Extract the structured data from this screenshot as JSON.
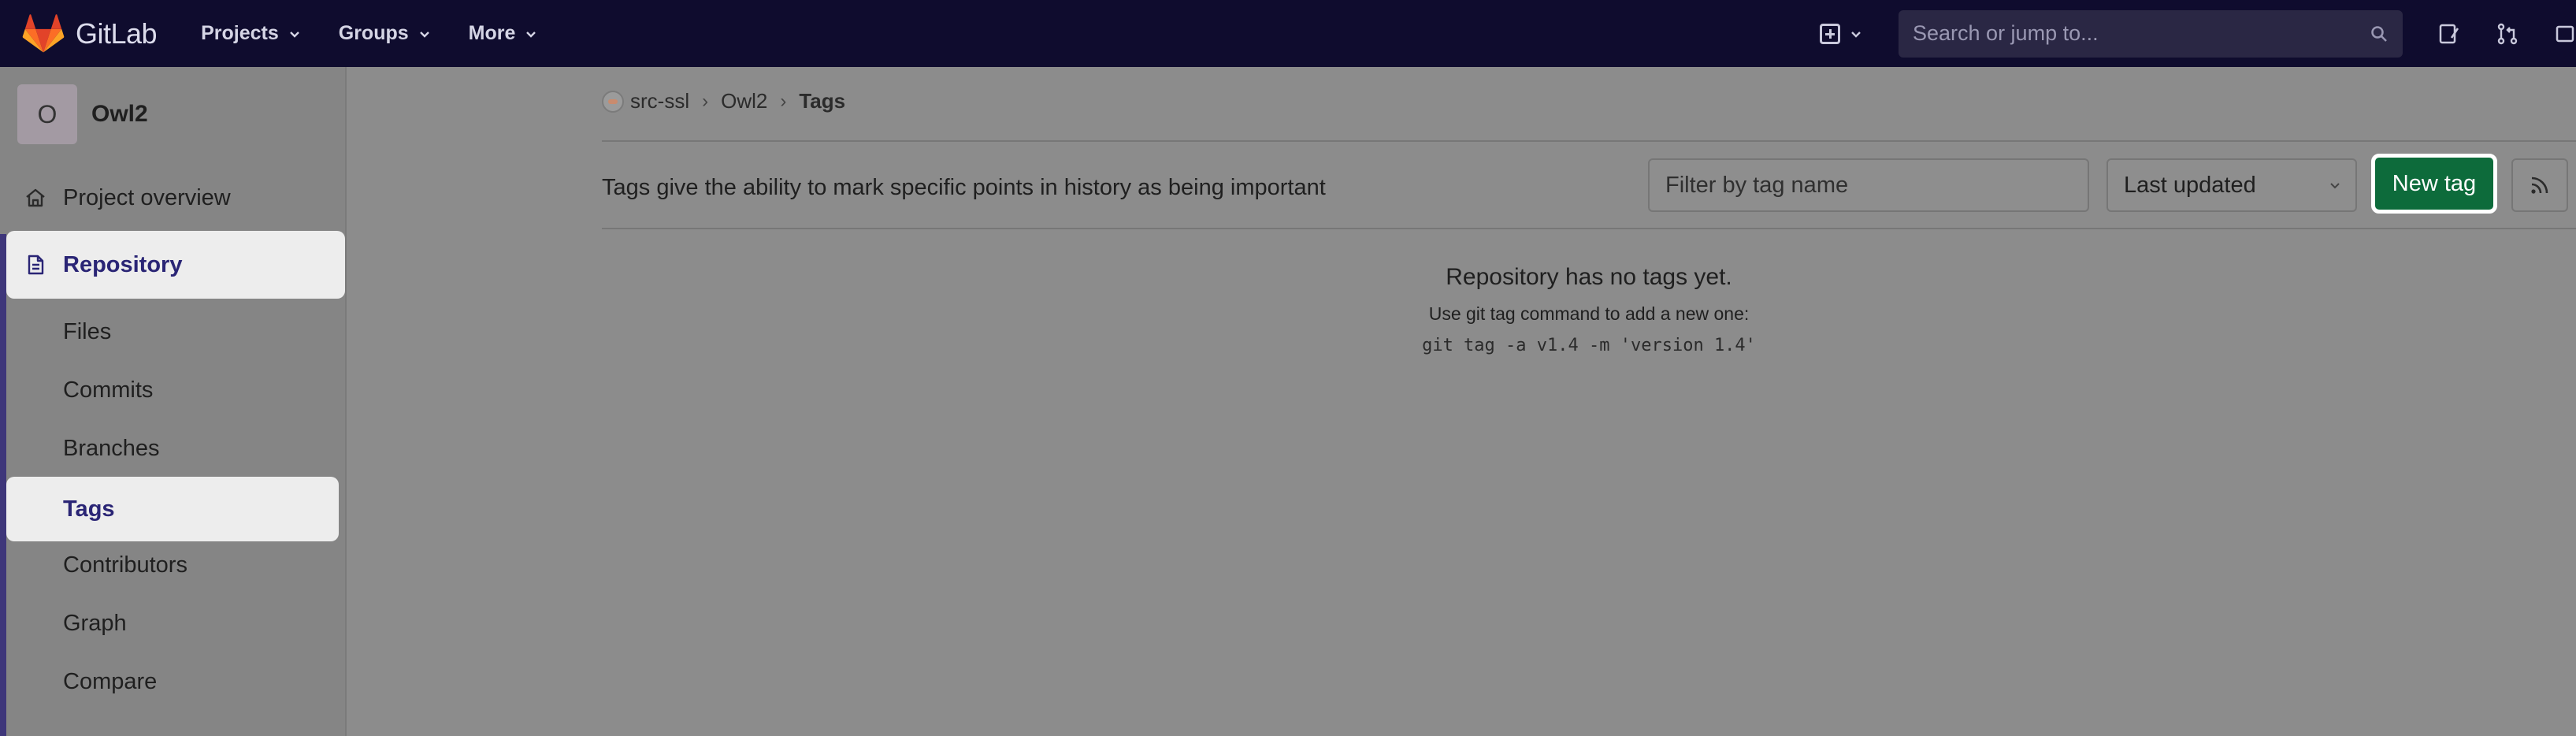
{
  "navbar": {
    "brand": "GitLab",
    "menu": [
      {
        "label": "Projects"
      },
      {
        "label": "Groups"
      },
      {
        "label": "More"
      }
    ],
    "search": {
      "placeholder": "Search or jump to..."
    },
    "icons": [
      "plus-square-icon",
      "issues-icon",
      "merge-request-icon"
    ]
  },
  "sidebar": {
    "avatar_letter": "O",
    "project_name": "Owl2",
    "items": [
      {
        "label": "Project overview",
        "icon": "home-icon"
      },
      {
        "label": "Repository",
        "icon": "document-icon"
      }
    ],
    "sub_items": [
      {
        "label": "Files"
      },
      {
        "label": "Commits"
      },
      {
        "label": "Branches"
      },
      {
        "label": "Tags"
      },
      {
        "label": "Contributors"
      },
      {
        "label": "Graph"
      },
      {
        "label": "Compare"
      }
    ]
  },
  "breadcrumb": {
    "group": "src-ssl",
    "project": "Owl2",
    "current": "Tags"
  },
  "tags_page": {
    "description": "Tags give the ability to mark specific points in history as being important",
    "filter_placeholder": "Filter by tag name",
    "sort_selected": "Last updated",
    "new_tag_label": "New tag",
    "empty_title": "Repository has no tags yet.",
    "empty_hint": "Use git tag command to add a new one:",
    "empty_command": "git tag -a v1.4 -m 'version 1.4'"
  },
  "colors": {
    "navbar_bg": "#0f0c2e",
    "active_text": "#2a2575",
    "new_tag_bg": "#0d6b3b"
  }
}
